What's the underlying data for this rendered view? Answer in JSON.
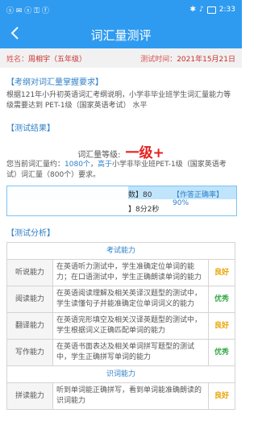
{
  "status_bar": {
    "left_icons": "ⓢ ✉ ⓢ ⚿ ⓕ",
    "time": "2:33",
    "icons": [
      "bluetooth-icon",
      "silent-icon",
      "battery-icon"
    ]
  },
  "header": {
    "title": "词汇量测评",
    "back_icon": "chevron-left-icon"
  },
  "info": {
    "name_label": "姓名：",
    "name_value": "周相宇（五年级）",
    "time_label": "测试时间：",
    "time_value": "2021年15月21日"
  },
  "requirements": {
    "title": "【考纲对词汇量掌握要求】",
    "text": "根据121年小升初英语词汇考纲说明，小学非毕业班学生词汇量能力等级需要达到 PET-1级（国家英语考试） 水平"
  },
  "results": {
    "title": "【测试结果】",
    "level_label": "词汇量等级:",
    "level_value": "一级+",
    "detail_pre": "您当前词汇量约：",
    "detail_count": "1080个",
    "detail_mid": "，",
    "detail_highlight": "高于",
    "detail_post": "小学非毕业班PET-1级（国家英语考试）词汇量（800个）要求。",
    "stats_line1_a": "数】80",
    "stats_line1_b": "【作答正确率】90%",
    "stats_line2": "】8分2秒"
  },
  "analysis": {
    "title": "【测试分析】",
    "groups": [
      {
        "name": "考试能力",
        "rows": [
          {
            "ability": "听说能力",
            "desc": "在英语听力测试中，学生准确定位单词的能力；在口语测试中，学生正确朗读单词的能力",
            "grade": "良好",
            "color": "#e8a400"
          },
          {
            "ability": "阅读能力",
            "desc": "在英语阅读理解及相关英译汉题型的测试中，学生读懂句子并能准确定位单词词义的能力",
            "grade": "优秀",
            "color": "#3aa84a"
          },
          {
            "ability": "翻译能力",
            "desc": "在英语完形填空及相关汉译英题型的测试中，学生根据词义正确匹配单词的能力",
            "grade": "良好",
            "color": "#e8a400"
          },
          {
            "ability": "写作能力",
            "desc": "在英语书面表达及相关单词拼写题型的测试中，学生正确拼写单词的能力",
            "grade": "优秀",
            "color": "#3aa84a"
          }
        ]
      },
      {
        "name": "识词能力",
        "rows": [
          {
            "ability": "拼读能力",
            "desc": "听到单词能正确拼写，看到单词能准确朗读的识词能力",
            "grade": "良好",
            "color": "#e8a400"
          }
        ]
      }
    ]
  }
}
